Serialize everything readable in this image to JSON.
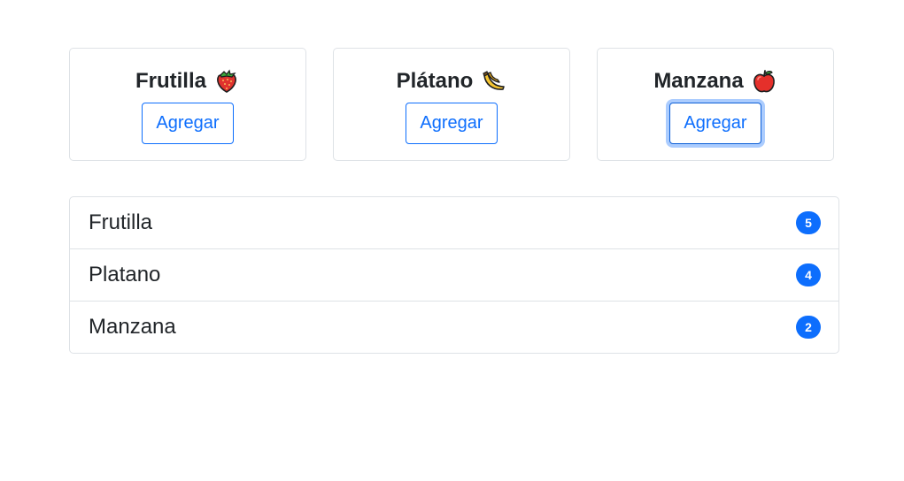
{
  "cards": [
    {
      "title": "Frutilla",
      "icon": "strawberry-icon",
      "button_label": "Agregar"
    },
    {
      "title": "Plátano",
      "icon": "banana-icon",
      "button_label": "Agregar"
    },
    {
      "title": "Manzana",
      "icon": "red-apple-icon",
      "button_label": "Agregar"
    }
  ],
  "list": [
    {
      "label": "Frutilla",
      "count": "5"
    },
    {
      "label": "Platano",
      "count": "4"
    },
    {
      "label": "Manzana",
      "count": "2"
    }
  ],
  "colors": {
    "accent": "#0d6efd",
    "border": "#dee2e6",
    "text": "#212529"
  }
}
